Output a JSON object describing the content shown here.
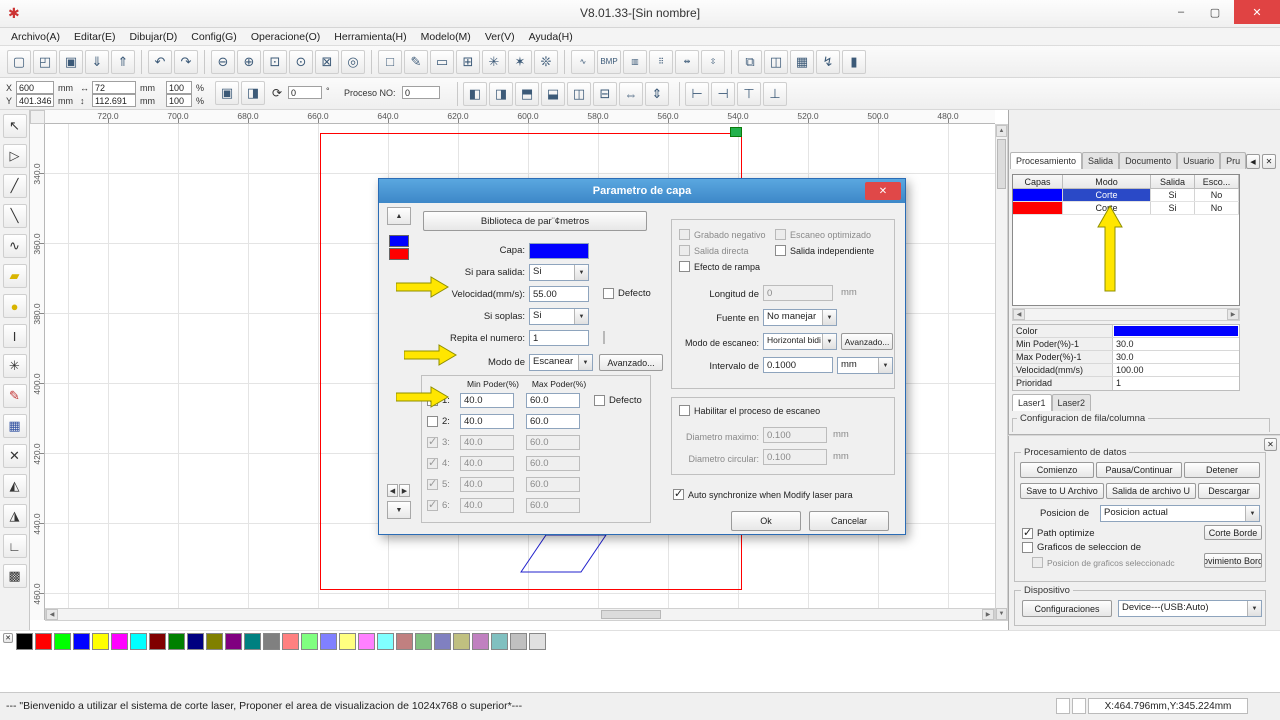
{
  "window": {
    "logo": "✱",
    "title": "V8.01.33-[Sin nombre]",
    "minimize": "–",
    "maximize": "▢",
    "close": "✕"
  },
  "menu": {
    "items": [
      "Archivo(A)",
      "Editar(E)",
      "Dibujar(D)",
      "Config(G)",
      "Operacione(O)",
      "Herramienta(H)",
      "Modelo(M)",
      "Ver(V)",
      "Ayuda(H)"
    ]
  },
  "toolbar_main": {
    "group1": [
      {
        "name": "new-file-icon",
        "glyph": "▢"
      },
      {
        "name": "open-file-icon",
        "glyph": "◰"
      },
      {
        "name": "save-file-icon",
        "glyph": "▣"
      },
      {
        "name": "import-file-icon",
        "glyph": "⇓"
      },
      {
        "name": "export-file-icon",
        "glyph": "⇑"
      }
    ],
    "group2": [
      {
        "name": "undo-icon",
        "glyph": "↶"
      },
      {
        "name": "redo-icon",
        "glyph": "↷"
      }
    ],
    "group3": [
      {
        "name": "zoom-out-icon",
        "glyph": "⊖"
      },
      {
        "name": "zoom-in-icon",
        "glyph": "⊕"
      },
      {
        "name": "zoom-window-icon",
        "glyph": "⊡"
      },
      {
        "name": "zoom-all-icon",
        "glyph": "⊙"
      },
      {
        "name": "zoom-selection-icon",
        "glyph": "⊠"
      },
      {
        "name": "zoom-page-icon",
        "glyph": "◎"
      }
    ],
    "group4": [
      {
        "name": "stop-render-icon",
        "glyph": "□"
      },
      {
        "name": "draw-check-icon",
        "glyph": "✎"
      },
      {
        "name": "eraser-icon",
        "glyph": "▭"
      },
      {
        "name": "simulate-icon",
        "glyph": "⊞"
      },
      {
        "name": "render-mode-1-icon",
        "glyph": "✳"
      },
      {
        "name": "render-mode-2-icon",
        "glyph": "✶"
      },
      {
        "name": "render-mode-3-icon",
        "glyph": "❊"
      }
    ],
    "group5": [
      {
        "name": "curve-smooth-icon",
        "glyph": "∿"
      },
      {
        "name": "bmp-tool-icon",
        "glyph": "BMP"
      },
      {
        "name": "outline-tool-icon",
        "glyph": "▥"
      },
      {
        "name": "node-edit-icon",
        "glyph": "⠿"
      },
      {
        "name": "distribute-h-icon",
        "glyph": "⇹"
      },
      {
        "name": "distribute-v-icon",
        "glyph": "⇳"
      }
    ],
    "group6": [
      {
        "name": "print-icon",
        "glyph": "⧉"
      },
      {
        "name": "print-preview-icon",
        "glyph": "◫"
      },
      {
        "name": "device-output-icon",
        "glyph": "▦"
      },
      {
        "name": "manual-laser-icon",
        "glyph": "↯"
      },
      {
        "name": "data-column-icon",
        "glyph": "▮"
      }
    ]
  },
  "toolbar_props": {
    "x_label": "X",
    "x_value": "600",
    "y_label": "Y",
    "y_value": "401.346",
    "unit_mm": "mm",
    "width_glyph": "↔",
    "width_value": "72",
    "height_glyph": "↕",
    "height_value": "112.691",
    "scale_x": "100",
    "scale_y": "100",
    "percent": "%",
    "lock_glyph": "▣",
    "mirror_glyph": "◨",
    "rotate_glyph": "⟳",
    "rotate_value": "0",
    "degree": "°",
    "proceso_label": "Proceso NO:",
    "proceso_value": "0",
    "align_icons": [
      {
        "name": "align-left-icon",
        "glyph": "◧"
      },
      {
        "name": "align-right-icon",
        "glyph": "◨"
      },
      {
        "name": "align-top-icon",
        "glyph": "⬒"
      },
      {
        "name": "align-bottom-icon",
        "glyph": "⬓"
      },
      {
        "name": "align-center-h-icon",
        "glyph": "◫"
      },
      {
        "name": "align-center-v-icon",
        "glyph": "⊟"
      },
      {
        "name": "same-width-icon",
        "glyph": "⇔"
      },
      {
        "name": "same-height-icon",
        "glyph": "⇕"
      }
    ],
    "attach_icons": [
      {
        "name": "attach-left-icon",
        "glyph": "⊢"
      },
      {
        "name": "attach-right-icon",
        "glyph": "⊣"
      },
      {
        "name": "attach-top-icon",
        "glyph": "⊤"
      },
      {
        "name": "attach-bottom-icon",
        "glyph": "⊥"
      }
    ]
  },
  "left_tools": {
    "icons": [
      {
        "name": "select-tool-icon",
        "glyph": "↖",
        "color": "#333333"
      },
      {
        "name": "node-edit-tool-icon",
        "glyph": "▷",
        "color": "#333333"
      },
      {
        "name": "line-tool-icon",
        "glyph": "╱",
        "color": "#333333"
      },
      {
        "name": "polyline-tool-icon",
        "glyph": "╲",
        "color": "#333333"
      },
      {
        "name": "curve-tool-icon",
        "glyph": "∿",
        "color": "#333333"
      },
      {
        "name": "rectangle-tool-icon",
        "glyph": "▰",
        "color": "#d8b400"
      },
      {
        "name": "ellipse-tool-icon",
        "glyph": "●",
        "color": "#d8b400"
      },
      {
        "name": "text-tool-icon",
        "glyph": "I",
        "color": "#333333"
      },
      {
        "name": "point-tool-icon",
        "glyph": "✳",
        "color": "#333333"
      },
      {
        "name": "pencil-tool-icon",
        "glyph": "✎",
        "color": "#c03030"
      },
      {
        "name": "capture-tool-icon",
        "glyph": "▦",
        "color": "#3050a0"
      },
      {
        "name": "delete-tool-icon",
        "glyph": "✕",
        "color": "#333333"
      },
      {
        "name": "mirror-vertical-tool-icon",
        "glyph": "◭",
        "color": "#333333"
      },
      {
        "name": "mirror-horizontal-tool-icon",
        "glyph": "◮",
        "color": "#333333"
      },
      {
        "name": "offset-tool-icon",
        "glyph": "∟",
        "color": "#333333"
      },
      {
        "name": "array-tool-icon",
        "glyph": "▩",
        "color": "#333333"
      }
    ]
  },
  "rulers": {
    "h": [
      "720.0",
      "700.0",
      "680.0",
      "660.0",
      "640.0",
      "620.0",
      "600.0",
      "580.0",
      "560.0",
      "540.0",
      "520.0",
      "500.0",
      "480.0"
    ],
    "v": [
      "340.0",
      "360.0",
      "380.0",
      "400.0",
      "420.0",
      "440.0",
      "460.0"
    ]
  },
  "canvas": {
    "frame_color": "#ff0000",
    "shape_color": "#2020cc",
    "handle_color": "#22b14c"
  },
  "dialog": {
    "title": "Parametro de capa",
    "close": "✕",
    "library_button": "Biblioteca de par¨¢metros",
    "layer_colors": {
      "current": "#0000ff",
      "second": "#ff0000"
    },
    "fields": {
      "capa_label": "Capa:",
      "salida_label": "Si para salida:",
      "salida_value": "Si",
      "velocidad_label": "Velocidad(mm/s):",
      "velocidad_value": "55.00",
      "defecto_label": "Defecto",
      "soplas_label": "Si soplas:",
      "soplas_value": "Si",
      "repita_label": "Repita el numero:",
      "repita_value": "1",
      "modo_label": "Modo de",
      "modo_value": "Escanear",
      "avanzado_label": "Avanzado..."
    },
    "power": {
      "min_header": "Min Poder(%)",
      "max_header": "Max Poder(%)",
      "defecto_label": "Defecto",
      "rows": [
        {
          "label": "1:",
          "min": "40.0",
          "max": "60.0",
          "checked": true
        },
        {
          "label": "2:",
          "min": "40.0",
          "max": "60.0",
          "checked": false
        },
        {
          "label": "3:",
          "min": "40.0",
          "max": "60.0",
          "checked": true
        },
        {
          "label": "4:",
          "min": "40.0",
          "max": "60.0",
          "checked": true
        },
        {
          "label": "5:",
          "min": "40.0",
          "max": "60.0",
          "checked": true
        },
        {
          "label": "6:",
          "min": "40.0",
          "max": "60.0",
          "checked": true
        }
      ]
    },
    "right": {
      "grabado": "Grabado negativo",
      "escaneo_opt": "Escaneo optimizado",
      "salida_directa": "Salida directa",
      "salida_indep": "Salida independiente",
      "rampa": "Efecto de rampa",
      "longitud_label": "Longitud de",
      "longitud_value": "0",
      "mm": "mm",
      "fuente_label": "Fuente en",
      "fuente_value": "No manejar",
      "modo_escaneo_label": "Modo de escaneo:",
      "modo_escaneo_value": "Horizontal bidi",
      "avanzado_label": "Avanzado...",
      "intervalo_label": "Intervalo de",
      "intervalo_value": "0.1000",
      "intervalo_unit": "mm",
      "habilitar": "Habilitar el proceso de escaneo",
      "habilitar_checked": false,
      "diam_max_label": "Diametro maximo:",
      "diam_max_value": "0.100",
      "diam_circ_label": "Diametro circular:",
      "diam_circ_value": "0.100",
      "auto_sync": "Auto synchronize when Modify laser para",
      "auto_sync_checked": true,
      "ok": "Ok",
      "cancel": "Cancelar"
    }
  },
  "right_panel": {
    "tabs": [
      "Procesamiento",
      "Salida",
      "Documento",
      "Usuario",
      "Pru"
    ],
    "tab_scroll": "◀",
    "close": "✕",
    "selection_color": "#2a49c7",
    "table": {
      "headers": [
        "Capas",
        "Modo",
        "Salida",
        "Esco..."
      ],
      "rows": [
        {
          "color": "#0000ff",
          "modo": "Corte",
          "salida": "Si",
          "esco": "No"
        },
        {
          "color": "#ff0000",
          "modo": "Corte",
          "salida": "Si",
          "esco": "No"
        }
      ]
    },
    "props": {
      "color_label": "Color",
      "color_value": "#0000ff",
      "rows": [
        {
          "label": "Min Poder(%)-1",
          "value": "30.0"
        },
        {
          "label": "Max Poder(%)-1",
          "value": "30.0"
        },
        {
          "label": "Velocidad(mm/s)",
          "value": "100.00"
        },
        {
          "label": "Prioridad",
          "value": "1"
        }
      ]
    },
    "laser_tabs": [
      "Laser1",
      "Laser2"
    ],
    "config_legend": "Configuracion de fila/columna"
  },
  "data_panel": {
    "close": "✕",
    "legend": "Procesamiento de datos",
    "buttons_row1": [
      "Comienzo",
      "Pausa/Continuar",
      "Detener"
    ],
    "buttons_row2": [
      "Save to U Archivo",
      "Salida de archivo U",
      "Descargar"
    ],
    "posicion_label": "Posicion de",
    "posicion_value": "Posicion actual",
    "path_optimize": "Path optimize",
    "path_optimize_checked": true,
    "corte_borde": "Corte Borde",
    "graficos_sel": "Graficos de seleccion de",
    "graficos_sel_checked": false,
    "posicion_graficos": "Posicion de graficos seleccionadc",
    "movimiento": "ovimiento Bord",
    "dispositivo_legend": "Dispositivo",
    "config_button": "Configuraciones",
    "device_value": "Device---(USB:Auto)"
  },
  "palette": {
    "close": "✕",
    "colors": [
      "#000000",
      "#FF0000",
      "#00FF00",
      "#0000FF",
      "#FFFF00",
      "#FF00FF",
      "#00FFFF",
      "#800000",
      "#008000",
      "#000080",
      "#808000",
      "#800080",
      "#008080",
      "#808080",
      "#FF8080",
      "#80FF80",
      "#8080FF",
      "#FFFF80",
      "#FF80FF",
      "#80FFFF",
      "#C08080",
      "#80C080",
      "#8080C0",
      "#C0C080",
      "#C080C0",
      "#80C0C0",
      "#C0C0C0",
      "#E0E0E0"
    ]
  },
  "statusbar": {
    "message": "--- \"Bienvenido a utilizar el sistema de corte laser, Proponer el area de visualizacion de 1024x768 o superior*---",
    "coords": "X:464.796mm,Y:345.224mm"
  },
  "annotations": {
    "color": "#ffe600"
  }
}
